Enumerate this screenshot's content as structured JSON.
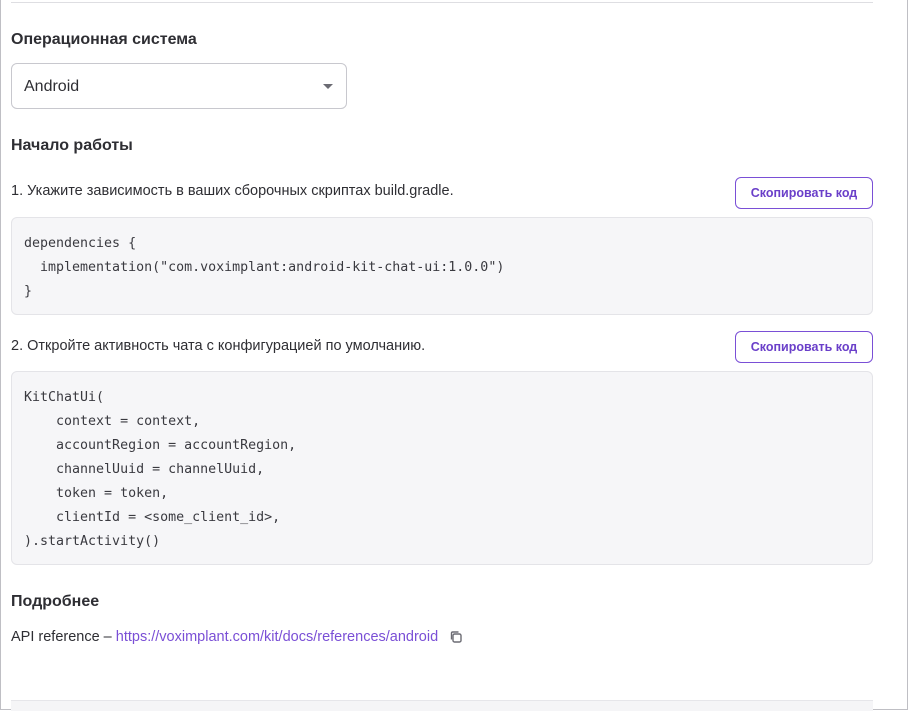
{
  "os_section": {
    "title": "Операционная система",
    "selected": "Android",
    "arrow_icon": "chevron-down-icon"
  },
  "start_section": {
    "title": "Начало работы",
    "steps": [
      {
        "text": "1. Укажите зависимость в ваших сборочных скриптах build.gradle.",
        "copy_label": "Скопировать код",
        "code_lines": [
          "dependencies {",
          "  implementation(\"com.voximplant:android-kit-chat-ui:1.0.0\")",
          "}"
        ]
      },
      {
        "text": "2. Откройте активность чата с конфигурацией по умолчанию.",
        "copy_label": "Скопировать код",
        "code_lines": [
          "KitChatUi(",
          "    context = context,",
          "    accountRegion = accountRegion,",
          "    channelUuid = channelUuid,",
          "    token = token,",
          "    clientId = <some_client_id>,",
          ").startActivity()"
        ]
      }
    ]
  },
  "more_section": {
    "title": "Подробнее",
    "api_label": "API reference – ",
    "api_link": "https://voximplant.com/kit/docs/references/android",
    "copy_icon": "copy-icon"
  },
  "colors": {
    "accent": "#7a4fd6",
    "text": "#2e2e33",
    "code_bg": "#f6f6f8"
  }
}
